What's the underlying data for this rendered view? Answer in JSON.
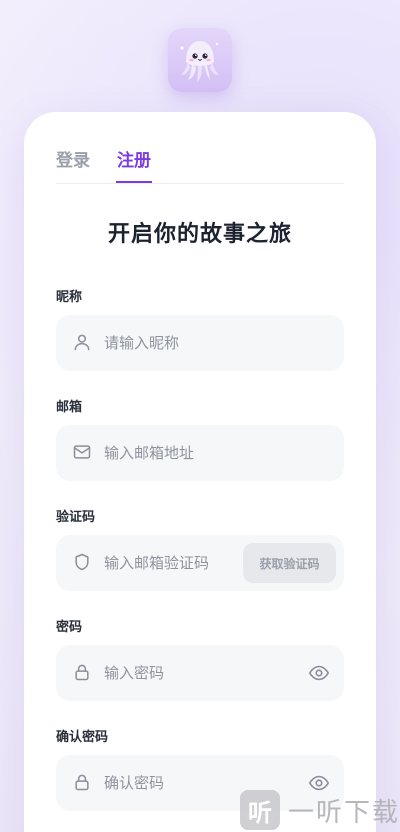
{
  "tabs": {
    "login": "登录",
    "register": "注册"
  },
  "heading": "开启你的故事之旅",
  "fields": {
    "nickname": {
      "label": "昵称",
      "placeholder": "请输入昵称",
      "icon": "user-icon"
    },
    "email": {
      "label": "邮箱",
      "placeholder": "输入邮箱地址",
      "icon": "mail-icon"
    },
    "code": {
      "label": "验证码",
      "placeholder": "输入邮箱验证码",
      "icon": "shield-icon",
      "button": "获取验证码"
    },
    "password": {
      "label": "密码",
      "placeholder": "输入密码",
      "icon": "lock-icon"
    },
    "confirm": {
      "label": "确认密码",
      "placeholder": "确认密码",
      "icon": "lock-icon"
    }
  },
  "colors": {
    "accent": "#7a3be0",
    "inactive_tab": "#9a9fab",
    "field_bg": "#f6f7f9"
  },
  "watermark": {
    "box_char": "听",
    "text": "一听下载"
  }
}
